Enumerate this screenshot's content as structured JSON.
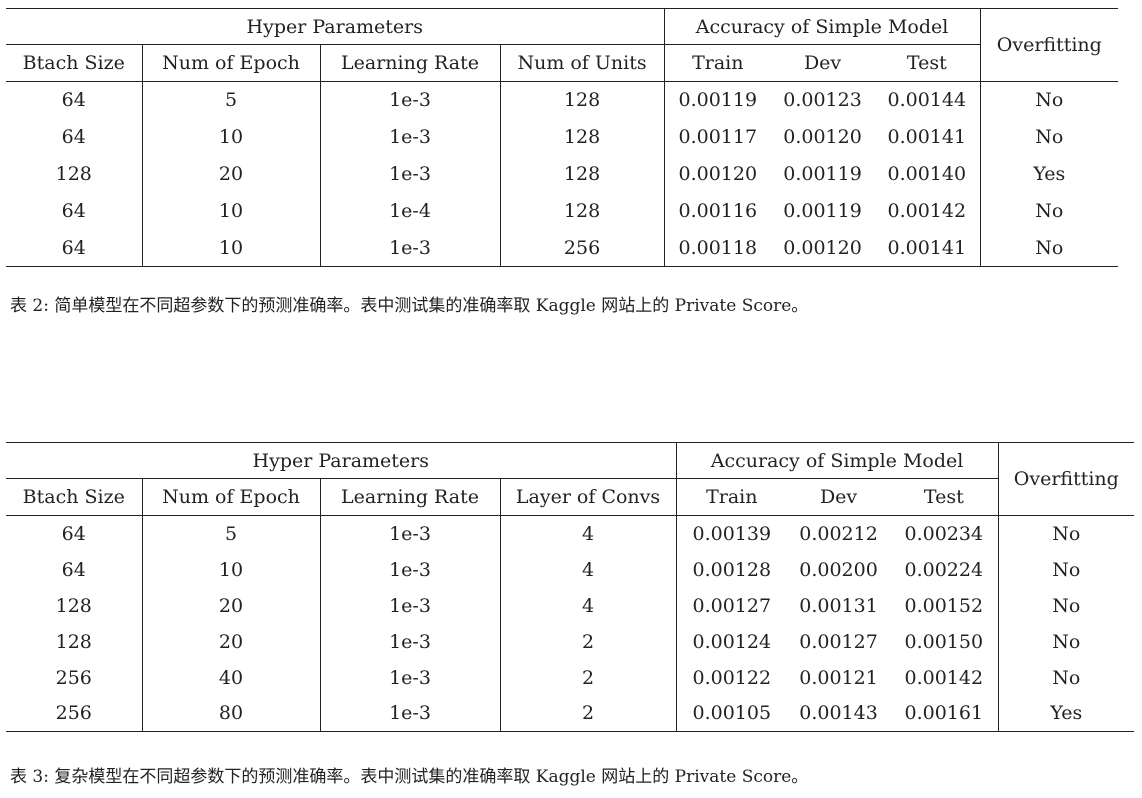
{
  "table2": {
    "headers": {
      "group_hyper": "Hyper Parameters",
      "group_acc": "Accuracy of Simple Model",
      "overfitting": "Overfitting",
      "batch": "Btach Size",
      "epoch": "Num of Epoch",
      "lr": "Learning Rate",
      "units": "Num of Units",
      "train": "Train",
      "dev": "Dev",
      "test": "Test"
    },
    "rows": [
      [
        "64",
        "5",
        "1e-3",
        "128",
        "0.00119",
        "0.00123",
        "0.00144",
        "No"
      ],
      [
        "64",
        "10",
        "1e-3",
        "128",
        "0.00117",
        "0.00120",
        "0.00141",
        "No"
      ],
      [
        "128",
        "20",
        "1e-3",
        "128",
        "0.00120",
        "0.00119",
        "0.00140",
        "Yes"
      ],
      [
        "64",
        "10",
        "1e-4",
        "128",
        "0.00116",
        "0.00119",
        "0.00142",
        "No"
      ],
      [
        "64",
        "10",
        "1e-3",
        "256",
        "0.00118",
        "0.00120",
        "0.00141",
        "No"
      ]
    ],
    "caption": "表 2: 简单模型在不同超参数下的预测准确率。表中测试集的准确率取 Kaggle 网站上的 Private Score。"
  },
  "table3": {
    "headers": {
      "group_hyper": "Hyper Parameters",
      "group_acc": "Accuracy of Simple Model",
      "overfitting": "Overfitting",
      "batch": "Btach Size",
      "epoch": "Num of Epoch",
      "lr": "Learning Rate",
      "convs": "Layer of Convs",
      "train": "Train",
      "dev": "Dev",
      "test": "Test"
    },
    "rows": [
      [
        "64",
        "5",
        "1e-3",
        "4",
        "0.00139",
        "0.00212",
        "0.00234",
        "No"
      ],
      [
        "64",
        "10",
        "1e-3",
        "4",
        "0.00128",
        "0.00200",
        "0.00224",
        "No"
      ],
      [
        "128",
        "20",
        "1e-3",
        "4",
        "0.00127",
        "0.00131",
        "0.00152",
        "No"
      ],
      [
        "128",
        "20",
        "1e-3",
        "2",
        "0.00124",
        "0.00127",
        "0.00150",
        "No"
      ],
      [
        "256",
        "40",
        "1e-3",
        "2",
        "0.00122",
        "0.00121",
        "0.00142",
        "No"
      ],
      [
        "256",
        "80",
        "1e-3",
        "2",
        "0.00105",
        "0.00143",
        "0.00161",
        "Yes"
      ]
    ],
    "caption": "表 3: 复杂模型在不同超参数下的预测准确率。表中测试集的准确率取 Kaggle 网站上的 Private Score。"
  }
}
